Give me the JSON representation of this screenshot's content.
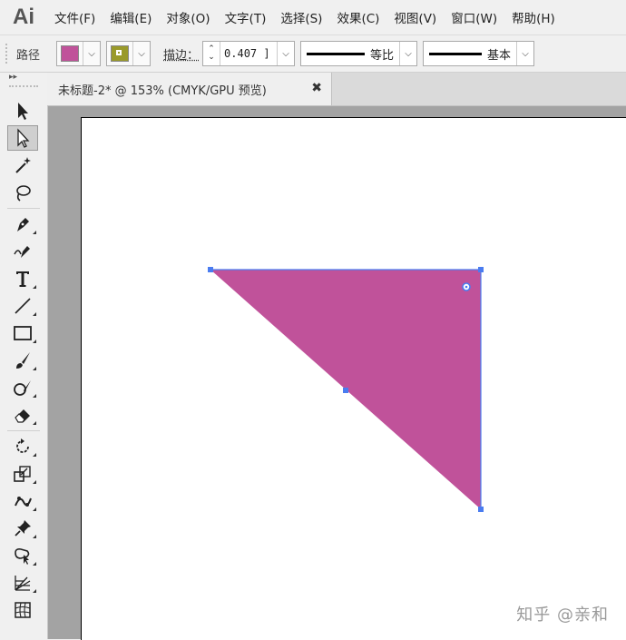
{
  "app": {
    "logo": "Ai"
  },
  "menu": [
    "文件(F)",
    "编辑(E)",
    "对象(O)",
    "文字(T)",
    "选择(S)",
    "效果(C)",
    "视图(V)",
    "窗口(W)",
    "帮助(H)"
  ],
  "control_bar": {
    "selection_type": "路径",
    "fill_color": "#c0529a",
    "stroke_color": "#9a9a2a",
    "stroke_label": "描边：",
    "stroke_weight": "0.407 ]",
    "profile_label": "等比",
    "brush_label": "基本"
  },
  "document_tab": {
    "title": "未标题-2* @ 153% (CMYK/GPU 预览)",
    "close_glyph": "✖"
  },
  "toolbox": {
    "collapse_glyph": "▸▸",
    "tools": [
      "selection-tool",
      "direct-selection-tool",
      "magic-wand-tool",
      "lasso-tool",
      "pen-tool",
      "curvature-tool",
      "type-tool",
      "line-segment-tool",
      "rectangle-tool",
      "paintbrush-tool",
      "shaper-tool",
      "eraser-tool",
      "rotate-tool",
      "scale-tool",
      "puppet-warp-tool",
      "pin-tool",
      "free-transform-tool",
      "perspective-grid-tool",
      "mesh-tool"
    ],
    "selected_tool": "direct-selection-tool"
  },
  "artwork": {
    "shape": "triangle",
    "fill": "#c0529a",
    "selection_color": "#4a7cf0"
  },
  "watermark": "知乎 @亲和"
}
